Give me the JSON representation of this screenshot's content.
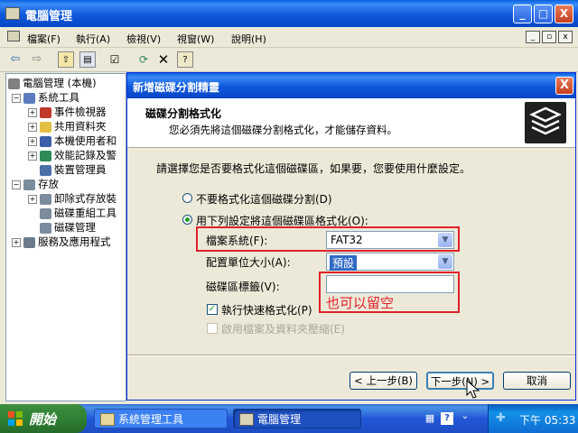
{
  "window": {
    "title": "電腦管理",
    "buttons": {
      "minimize": "_",
      "maximize": "□",
      "close": "X"
    }
  },
  "menubar": {
    "items": [
      "檔案(F)",
      "執行(A)",
      "檢視(V)",
      "視窗(W)",
      "說明(H)"
    ],
    "mdi_buttons": [
      "_",
      "▫",
      "x"
    ]
  },
  "toolbar": {
    "icons": [
      "back-arrow-icon",
      "forward-arrow-icon",
      "up-folder-icon",
      "show-hide-tree-icon",
      "properties-icon",
      "refresh-icon",
      "delete-icon",
      "help-icon"
    ]
  },
  "tree": {
    "nodes": [
      {
        "label": "電腦管理 (本機)",
        "expander": "",
        "icon_color": "#808080"
      },
      {
        "label": "系統工具",
        "expander": "−",
        "icon_color": "#5a7bbf"
      },
      {
        "label": "事件檢視器",
        "expander": "+",
        "icon_color": "#c0392b"
      },
      {
        "label": "共用資料夾",
        "expander": "+",
        "icon_color": "#e3c042"
      },
      {
        "label": "本機使用者和",
        "expander": "+",
        "icon_color": "#3a5fa8"
      },
      {
        "label": "效能記錄及警",
        "expander": "+",
        "icon_color": "#2e8b57"
      },
      {
        "label": "裝置管理員",
        "expander": "",
        "icon_color": "#4a6fa8"
      },
      {
        "label": "存放",
        "expander": "−",
        "icon_color": "#7a8c9e"
      },
      {
        "label": "卸除式存放裝",
        "expander": "+",
        "icon_color": "#7a8c9e"
      },
      {
        "label": "磁碟重組工具",
        "expander": "",
        "icon_color": "#7a8c9e"
      },
      {
        "label": "磁碟管理",
        "expander": "",
        "icon_color": "#7a8c9e"
      },
      {
        "label": "服務及應用程式",
        "expander": "+",
        "icon_color": "#6b7b8c"
      }
    ]
  },
  "dialog": {
    "title": "新增磁碟分割精靈",
    "close": "X",
    "header_title": "磁碟分割格式化",
    "header_subtitle": "您必須先將這個磁碟分割格式化，才能儲存資料。",
    "prompt": "請選擇您是否要格式化這個磁碟區，如果要，您要使用什麼設定。",
    "option_no_format": "不要格式化這個磁碟分割(D)",
    "option_format": "用下列設定將這個磁碟區格式化(O):",
    "selected_option": "format",
    "filesystem_label": "檔案系統(F):",
    "filesystem_value": "FAT32",
    "allocation_label": "配置單位大小(A):",
    "allocation_value": "預設",
    "volume_label_label": "磁碟區標籤(V):",
    "volume_label_value": "",
    "annotation": "也可以留空",
    "quick_format_label": "執行快速格式化(P)",
    "quick_format_checked": true,
    "compression_label": "啟用檔案及資料夾壓縮(E)",
    "back_button": "< 上一步(B)",
    "next_button": "下一步(N) >",
    "cancel_button": "取消",
    "accent_red": "#e0202a"
  },
  "taskbar": {
    "start_label": "開始",
    "tasks": [
      "系統管理工具",
      "電腦管理"
    ],
    "active_task": "電腦管理",
    "clock": "下午 05:33"
  }
}
